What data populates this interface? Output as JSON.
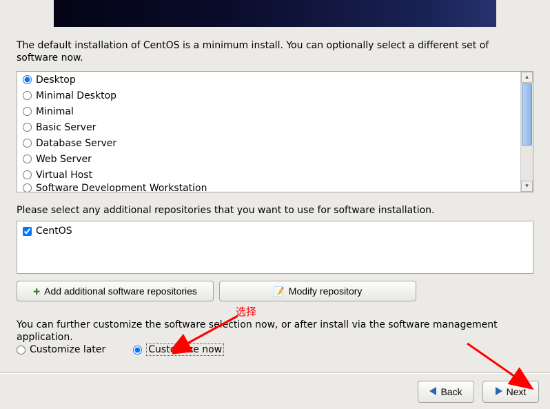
{
  "description": "The default installation of CentOS is a minimum install. You can optionally select a different set of software now.",
  "install_types": {
    "selected_index": 0,
    "items": [
      "Desktop",
      "Minimal Desktop",
      "Minimal",
      "Basic Server",
      "Database Server",
      "Web Server",
      "Virtual Host",
      "Software Development Workstation"
    ]
  },
  "repo_label": "Please select any additional repositories that you want to use for software installation.",
  "repos": {
    "items": [
      {
        "label": "CentOS",
        "checked": true
      }
    ]
  },
  "buttons": {
    "add_repo": "Add additional software repositories",
    "modify_repo": "Modify repository",
    "back": "Back",
    "next": "Next"
  },
  "customize": {
    "desc": "You can further customize the software selection now, or after install via the software management application.",
    "later": "Customize later",
    "now": "Customize now",
    "selected": "now"
  },
  "annotation": {
    "label": "选择"
  }
}
